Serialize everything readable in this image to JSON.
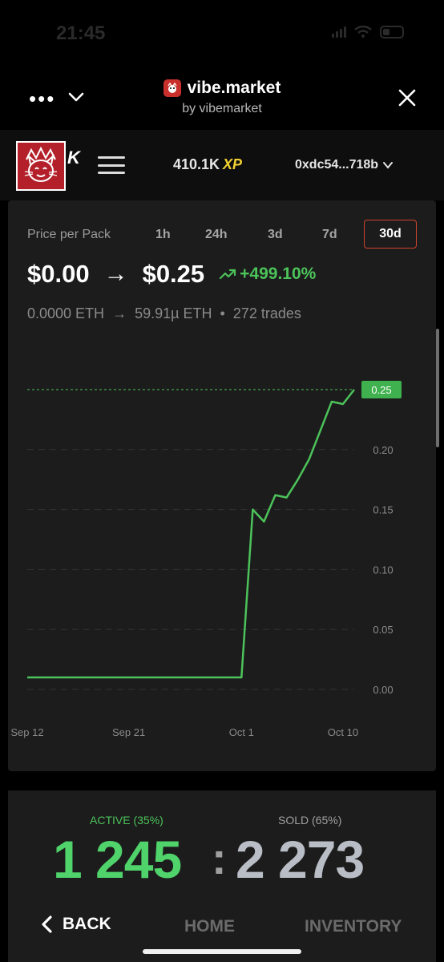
{
  "status_bar": {
    "time": "21:45"
  },
  "app_header": {
    "title": "vibe.market",
    "subtitle": "by vibemarket",
    "more_label": "•••"
  },
  "navbar": {
    "brand_suffix": "K",
    "xp_value": "410.1K",
    "xp_label": "XP",
    "wallet": "0xdc54...718b"
  },
  "chart_panel": {
    "label": "Price per Pack",
    "timeframes": [
      "1h",
      "24h",
      "3d",
      "7d",
      "30d"
    ],
    "active_timeframe": "30d",
    "price_from": "$0.00",
    "price_to": "$0.25",
    "change": "+499.10%",
    "eth_from": "0.0000 ETH",
    "eth_to": "59.91µ ETH",
    "trades": "272 trades"
  },
  "chart_data": {
    "type": "line",
    "title": "",
    "xlabel": "",
    "ylabel": "",
    "x_ticks": [
      "Sep 12",
      "Sep 21",
      "Oct 1",
      "Oct 10"
    ],
    "y_ticks": [
      "0.00",
      "0.05",
      "0.10",
      "0.15",
      "0.20",
      "0.25"
    ],
    "ylim": [
      0,
      0.25
    ],
    "current_value_label": "0.25",
    "grid": true,
    "series": [
      {
        "color": "#4cc35a",
        "points": [
          [
            "Sep 12",
            0.01
          ],
          [
            "Sep 16",
            0.01
          ],
          [
            "Sep 21",
            0.01
          ],
          [
            "Sep 26",
            0.01
          ],
          [
            "Sep 30",
            0.01
          ],
          [
            "Oct 1",
            0.01
          ],
          [
            "Oct 2",
            0.15
          ],
          [
            "Oct 3",
            0.14
          ],
          [
            "Oct 4",
            0.162
          ],
          [
            "Oct 5",
            0.16
          ],
          [
            "Oct 6",
            0.175
          ],
          [
            "Oct 7",
            0.192
          ],
          [
            "Oct 9",
            0.24
          ],
          [
            "Oct 10",
            0.238
          ],
          [
            "Oct 11",
            0.25
          ]
        ]
      }
    ]
  },
  "ratio": {
    "active_label": "ACTIVE (35%)",
    "sold_label": "SOLD (65%)",
    "active_count": "1 245",
    "separator": ":",
    "sold_count": "2 273"
  },
  "bottom_nav": {
    "back": "BACK",
    "home": "HOME",
    "inventory": "INVENTORY"
  },
  "colors": {
    "accent_green": "#4cc35a",
    "xp_yellow": "#f2d230",
    "active_tab_border": "#d0432e",
    "card_bg": "#1c1c1c"
  }
}
